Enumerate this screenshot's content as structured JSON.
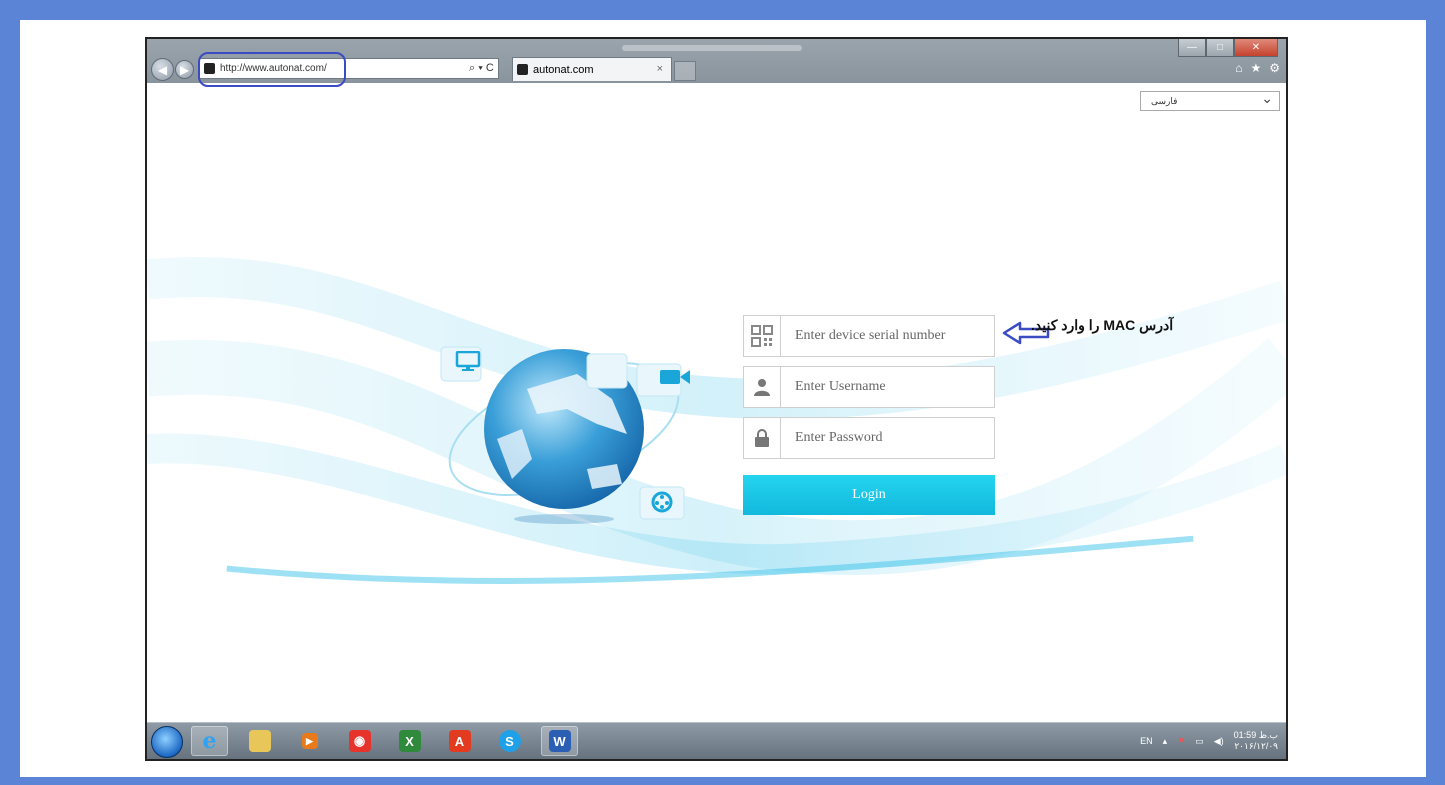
{
  "browser": {
    "url": "http://www.autonat.com/",
    "tab_title": "autonat.com",
    "search_glyph": "⌕ ▾ C",
    "tab_close": "×",
    "window_buttons": [
      "—",
      "□",
      "✕"
    ],
    "right_icons": [
      "⌂",
      "★",
      "⚙"
    ]
  },
  "page": {
    "language_selected": "فارسی",
    "serial_placeholder": "Enter device serial number",
    "username_placeholder": "Enter Username",
    "password_placeholder": "Enter Password",
    "login_label": "Login"
  },
  "annotation": {
    "text": "آدرس MAC را وارد کنید."
  },
  "taskbar": {
    "items": [
      "internet-explorer",
      "file-explorer",
      "media-player",
      "camera-app",
      "excel",
      "pdf-reader",
      "skype",
      "word"
    ],
    "item_letters": {
      "word": "W",
      "skype": "S",
      "pdf-reader": "A"
    },
    "lang": "EN",
    "time": "01:59 ب.ظ",
    "date": "۲۰۱۶/۱۲/۰۹"
  },
  "colors": {
    "frame": "#5b84d6",
    "login_button": "#1ec8e8",
    "annotation_arrow": "#3b4bc3"
  }
}
